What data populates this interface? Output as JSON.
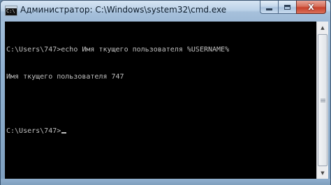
{
  "window": {
    "title": "Администратор: C:\\Windows\\system32\\cmd.exe",
    "icon_text": "C:\\",
    "icon_name": "cmd-icon"
  },
  "caption_buttons": {
    "minimize": "minimize-icon",
    "maximize": "maximize-icon",
    "close_label": "X"
  },
  "console": {
    "lines": [
      "C:\\Users\\747>echo Имя ткущего пользователя %USERNAME%",
      "Имя ткущего пользователя 747",
      "",
      "C:\\Users\\747>"
    ],
    "text_color": "#c0c0c0",
    "background_color": "#000000"
  },
  "scrollbar": {
    "up_arrow": "▲",
    "down_arrow": "▼"
  }
}
